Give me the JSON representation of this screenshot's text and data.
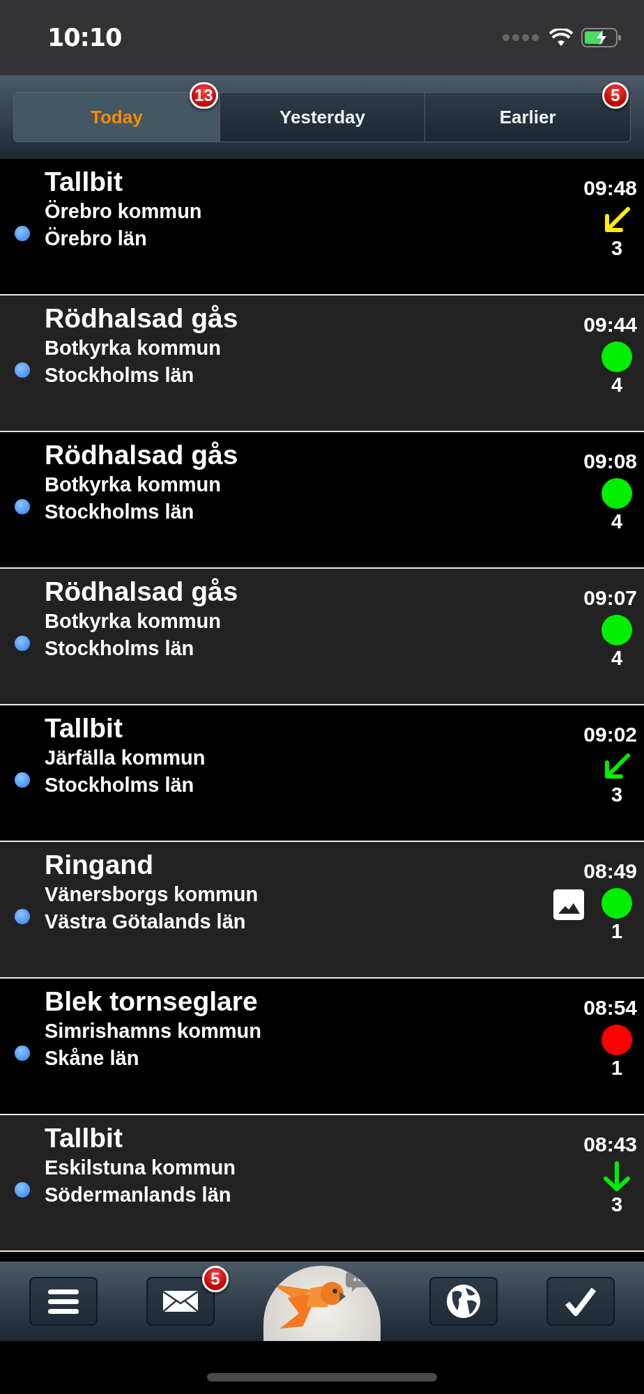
{
  "status_bar": {
    "time": "10:10"
  },
  "tabs": [
    {
      "label": "Today",
      "selected": true,
      "badge": "13"
    },
    {
      "label": "Yesterday",
      "selected": false
    },
    {
      "label": "Earlier",
      "selected": false,
      "badge": "5"
    }
  ],
  "rows": [
    {
      "name": "Tallbit",
      "municipality": "Örebro kommun",
      "county": "Örebro län",
      "time": "09:48",
      "unread": true,
      "has_image": false,
      "indicator": {
        "kind": "arrow-sw",
        "color": "#ffee00"
      },
      "count": "3"
    },
    {
      "name": "Rödhalsad gås",
      "municipality": "Botkyrka kommun",
      "county": "Stockholms län",
      "time": "09:44",
      "unread": true,
      "has_image": false,
      "indicator": {
        "kind": "dot",
        "color": "#00ee00"
      },
      "count": "4"
    },
    {
      "name": "Rödhalsad gås",
      "municipality": "Botkyrka kommun",
      "county": "Stockholms län",
      "time": "09:08",
      "unread": true,
      "has_image": false,
      "indicator": {
        "kind": "dot",
        "color": "#00ee00"
      },
      "count": "4"
    },
    {
      "name": "Rödhalsad gås",
      "municipality": "Botkyrka kommun",
      "county": "Stockholms län",
      "time": "09:07",
      "unread": true,
      "has_image": false,
      "indicator": {
        "kind": "dot",
        "color": "#00ee00"
      },
      "count": "4"
    },
    {
      "name": "Tallbit",
      "municipality": "Järfälla kommun",
      "county": "Stockholms län",
      "time": "09:02",
      "unread": true,
      "has_image": false,
      "indicator": {
        "kind": "arrow-sw",
        "color": "#00ee00"
      },
      "count": "3"
    },
    {
      "name": "Ringand",
      "municipality": "Vänersborgs kommun",
      "county": "Västra Götalands län",
      "time": "08:49",
      "unread": true,
      "has_image": true,
      "indicator": {
        "kind": "dot",
        "color": "#00ee00"
      },
      "count": "1"
    },
    {
      "name": "Blek tornseglare",
      "municipality": "Simrishamns kommun",
      "county": "Skåne län",
      "time": "08:54",
      "unread": true,
      "has_image": false,
      "indicator": {
        "kind": "dot",
        "color": "#ff0000"
      },
      "count": "1"
    },
    {
      "name": "Tallbit",
      "municipality": "Eskilstuna kommun",
      "county": "Södermanlands län",
      "time": "08:43",
      "unread": true,
      "has_image": false,
      "indicator": {
        "kind": "arrow-s",
        "color": "#00ee00"
      },
      "count": "3"
    }
  ],
  "toolbar": [
    {
      "kind": "menu"
    },
    {
      "kind": "mail",
      "badge": "5"
    },
    {
      "kind": "logo"
    },
    {
      "kind": "globe"
    },
    {
      "kind": "check"
    }
  ]
}
